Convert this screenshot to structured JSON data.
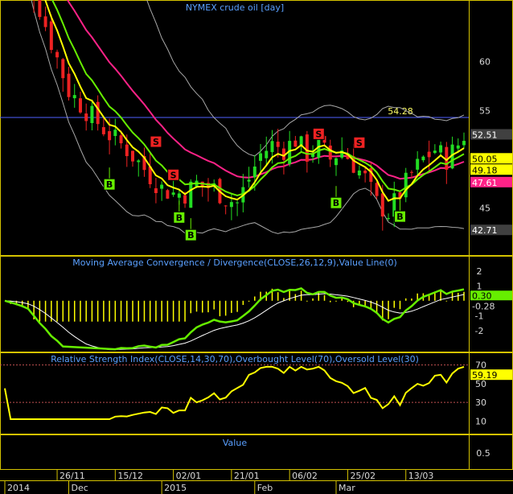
{
  "colors": {
    "background": "#000000",
    "panel_border": "#d4c200",
    "title_text": "#5aa0ff",
    "axis_text": "#d8d8d8",
    "candle_up": "#22dd22",
    "candle_down": "#ee2222",
    "ma_fast": "#ffff00",
    "ma_mid": "#66ee00",
    "ma_slow": "#ff2288",
    "bollinger": "#a8a8a8",
    "resistance": "#5060ff",
    "macd_hist": "#ffff00",
    "macd_line": "#66ee00",
    "signal_line": "#ffffff",
    "rsi_line": "#ffff00",
    "rsi_levels": "#c05050",
    "buy_marker": "#66ee00",
    "sell_marker": "#ee2222"
  },
  "chart_data": [
    {
      "type": "candlestick",
      "title": "NYMEX crude oil [day]",
      "ylim": [
        40.5,
        66
      ],
      "y_ticks": [
        45,
        50,
        55,
        60
      ],
      "resistance": {
        "value": 54.28,
        "label": "54.28"
      },
      "price_labels": [
        {
          "value": 52.51,
          "label": "52.51",
          "color": "#404040",
          "text": "#ffffff"
        },
        {
          "value": 50.05,
          "label": "50.05",
          "color": "#ffff00",
          "text": "#000000"
        },
        {
          "value": 49.18,
          "label": "49.18",
          "color": "#ffff00",
          "text": "#000000"
        },
        {
          "value": 47.61,
          "label": "47.61",
          "color": "#ff2288",
          "text": "#ffffff"
        },
        {
          "value": 42.71,
          "label": "42.71",
          "color": "#404040",
          "text": "#ffffff"
        }
      ],
      "buy_markers": [
        {
          "day": 18,
          "price": 47.5,
          "label": "B"
        },
        {
          "day": 30,
          "price": 44.1,
          "label": "B"
        },
        {
          "day": 32,
          "price": 42.3,
          "label": "B"
        },
        {
          "day": 57,
          "price": 45.6,
          "label": "B"
        },
        {
          "day": 68,
          "price": 44.2,
          "label": "B"
        }
      ],
      "sell_markers": [
        {
          "day": 26,
          "price": 51.8,
          "label": "S"
        },
        {
          "day": 29,
          "price": 48.4,
          "label": "S"
        },
        {
          "day": 54,
          "price": 52.6,
          "label": "S"
        },
        {
          "day": 61,
          "price": 51.7,
          "label": "S"
        }
      ]
    },
    {
      "type": "macd",
      "title": "Moving Average Convergence / Divergence(CLOSE,26,12,9),Value Line(0)",
      "ylim": [
        -3.2,
        2.8
      ],
      "y_ticks": [
        2,
        1,
        -1,
        -2
      ],
      "value_labels": [
        {
          "value": 0.3,
          "label": "0.30"
        },
        {
          "value": -0.28,
          "label": "-0.28"
        }
      ]
    },
    {
      "type": "rsi",
      "title": "Relative Strength Index(CLOSE,14,30,70),Overbought Level(70),Oversold Level(30)",
      "ylim": [
        0,
        80
      ],
      "y_ticks": [
        70,
        50,
        30,
        10
      ],
      "levels": [
        70,
        30
      ],
      "value_label": {
        "value": 59.19,
        "label": "59.19"
      }
    },
    {
      "type": "volume",
      "title": "Value",
      "y_ticks": [
        0.5
      ]
    }
  ],
  "x_axis": {
    "date_ticks": [
      {
        "day": 9,
        "label": "26/11"
      },
      {
        "day": 19,
        "label": "15/12"
      },
      {
        "day": 29,
        "label": "02/01"
      },
      {
        "day": 39,
        "label": "21/01"
      },
      {
        "day": 49,
        "label": "06/02"
      },
      {
        "day": 59,
        "label": "25/02"
      },
      {
        "day": 69,
        "label": "13/03"
      }
    ],
    "period_ticks": [
      {
        "day": 0,
        "label": "2014"
      },
      {
        "day": 11,
        "label": "Dec"
      },
      {
        "day": 27,
        "label": "2015"
      },
      {
        "day": 43,
        "label": "Feb"
      },
      {
        "day": 57,
        "label": "Mar"
      }
    ]
  }
}
